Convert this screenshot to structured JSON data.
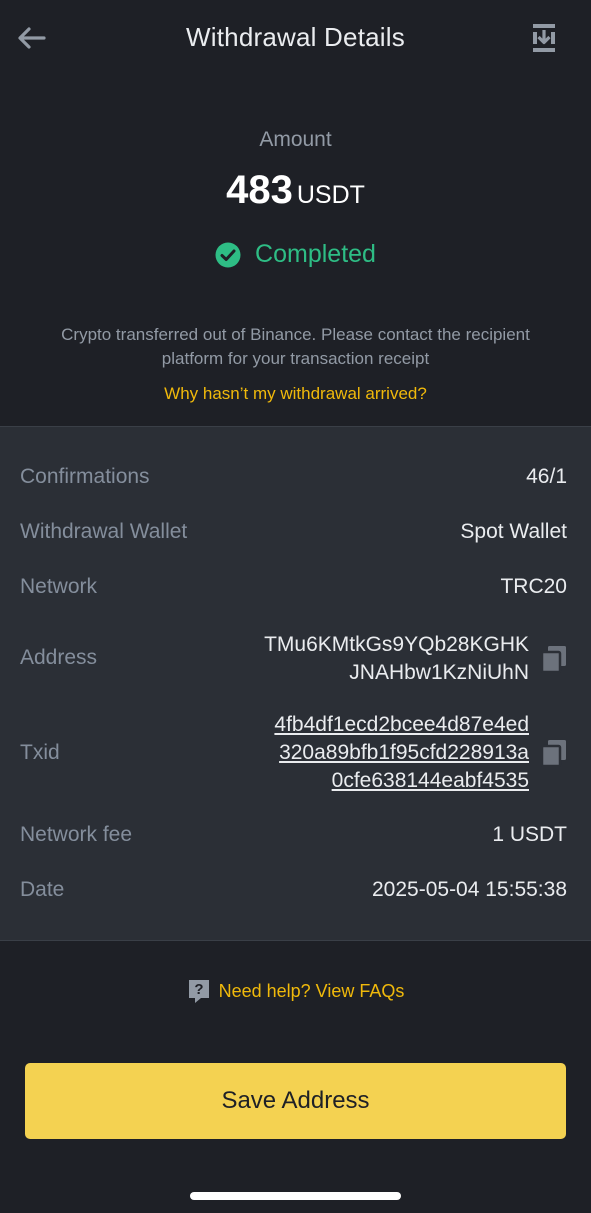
{
  "header": {
    "title": "Withdrawal Details",
    "back_icon": "arrow-left-icon",
    "export_icon": "download-export-icon"
  },
  "amount": {
    "label": "Amount",
    "value": "483",
    "unit": "USDT"
  },
  "status": {
    "text": "Completed",
    "icon": "check-circle-icon",
    "color": "#2ebd85"
  },
  "notice": {
    "line1": "Crypto transferred out of Binance. Please contact the recipient",
    "line2": "platform for your transaction receipt",
    "link": "Why hasn’t my withdrawal arrived?"
  },
  "details": {
    "confirmations": {
      "label": "Confirmations",
      "value": "46/1"
    },
    "wallet": {
      "label": "Withdrawal Wallet",
      "value": "Spot Wallet"
    },
    "network": {
      "label": "Network",
      "value": "TRC20"
    },
    "address": {
      "label": "Address",
      "lines": [
        "TMu6KMtkGs9YQb28KGHK",
        "JNAHbw1KzNiUhN"
      ]
    },
    "txid": {
      "label": "Txid",
      "lines": [
        "4fb4df1ecd2bcee4d87e4ed",
        "320a89bfb1f95cfd228913a",
        "0cfe638144eabf4535"
      ]
    },
    "fee": {
      "label": "Network fee",
      "value": "1 USDT"
    },
    "date": {
      "label": "Date",
      "value": "2025-05-04 15:55:38"
    }
  },
  "help": {
    "text": "Need help? View FAQs",
    "icon": "help-question-icon"
  },
  "footer": {
    "save_label": "Save Address"
  },
  "colors": {
    "background": "#1e2026",
    "panel": "#2b2f36",
    "accent": "#f0b90b",
    "button": "#f4d251",
    "success": "#2ebd85"
  }
}
